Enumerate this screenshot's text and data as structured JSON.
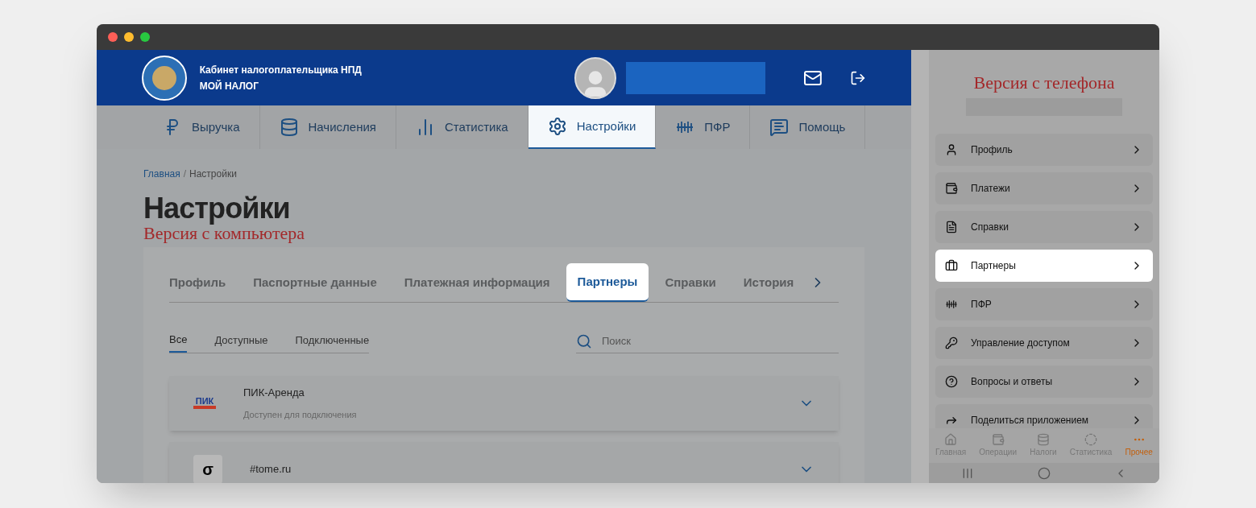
{
  "header": {
    "title": "Кабинет налогоплательщика НПД",
    "subtitle": "МОЙ НАЛОГ"
  },
  "nav": [
    {
      "label": "Выручка",
      "selected": false
    },
    {
      "label": "Начисления",
      "selected": false
    },
    {
      "label": "Статистика",
      "selected": false
    },
    {
      "label": "Настройки",
      "selected": true
    },
    {
      "label": "ПФР",
      "selected": false
    },
    {
      "label": "Помощь",
      "selected": false
    }
  ],
  "breadcrumb": {
    "crumbs": [
      "Главная",
      "Настройки"
    ],
    "separator": "/"
  },
  "page_title": "Настройки",
  "desktop_note": "Версия с компьютера",
  "settings_tabs": [
    {
      "label": "Профиль",
      "selected": false
    },
    {
      "label": "Паспортные данные",
      "selected": false
    },
    {
      "label": "Платежная информация",
      "selected": false
    },
    {
      "label": "Партнеры",
      "selected": true
    },
    {
      "label": "Справки",
      "selected": false
    },
    {
      "label": "История",
      "selected": false
    }
  ],
  "filters": [
    {
      "label": "Все",
      "selected": true
    },
    {
      "label": "Доступные",
      "selected": false
    },
    {
      "label": "Подключенные",
      "selected": false
    }
  ],
  "search": {
    "placeholder": "Поиск"
  },
  "partners": [
    {
      "name": "ПИК-Аренда",
      "status": "Доступен для подключения",
      "logo_text": "ПИК"
    },
    {
      "name": "#tome.ru",
      "logo_text": "σ"
    }
  ],
  "phone": {
    "note": "Версия с телефона",
    "menu": [
      {
        "label": "Профиль",
        "selected": false
      },
      {
        "label": "Платежи",
        "selected": false
      },
      {
        "label": "Справки",
        "selected": false
      },
      {
        "label": "Партнеры",
        "selected": true
      },
      {
        "label": "ПФР",
        "selected": false
      },
      {
        "label": "Управление доступом",
        "selected": false
      },
      {
        "label": "Вопросы и ответы",
        "selected": false
      },
      {
        "label": "Поделиться приложением",
        "selected": false
      }
    ],
    "tabbar": [
      {
        "label": "Главная",
        "selected": false
      },
      {
        "label": "Операции",
        "selected": false
      },
      {
        "label": "Налоги",
        "selected": false
      },
      {
        "label": "Статистика",
        "selected": false
      },
      {
        "label": "Прочее",
        "selected": true
      }
    ]
  }
}
